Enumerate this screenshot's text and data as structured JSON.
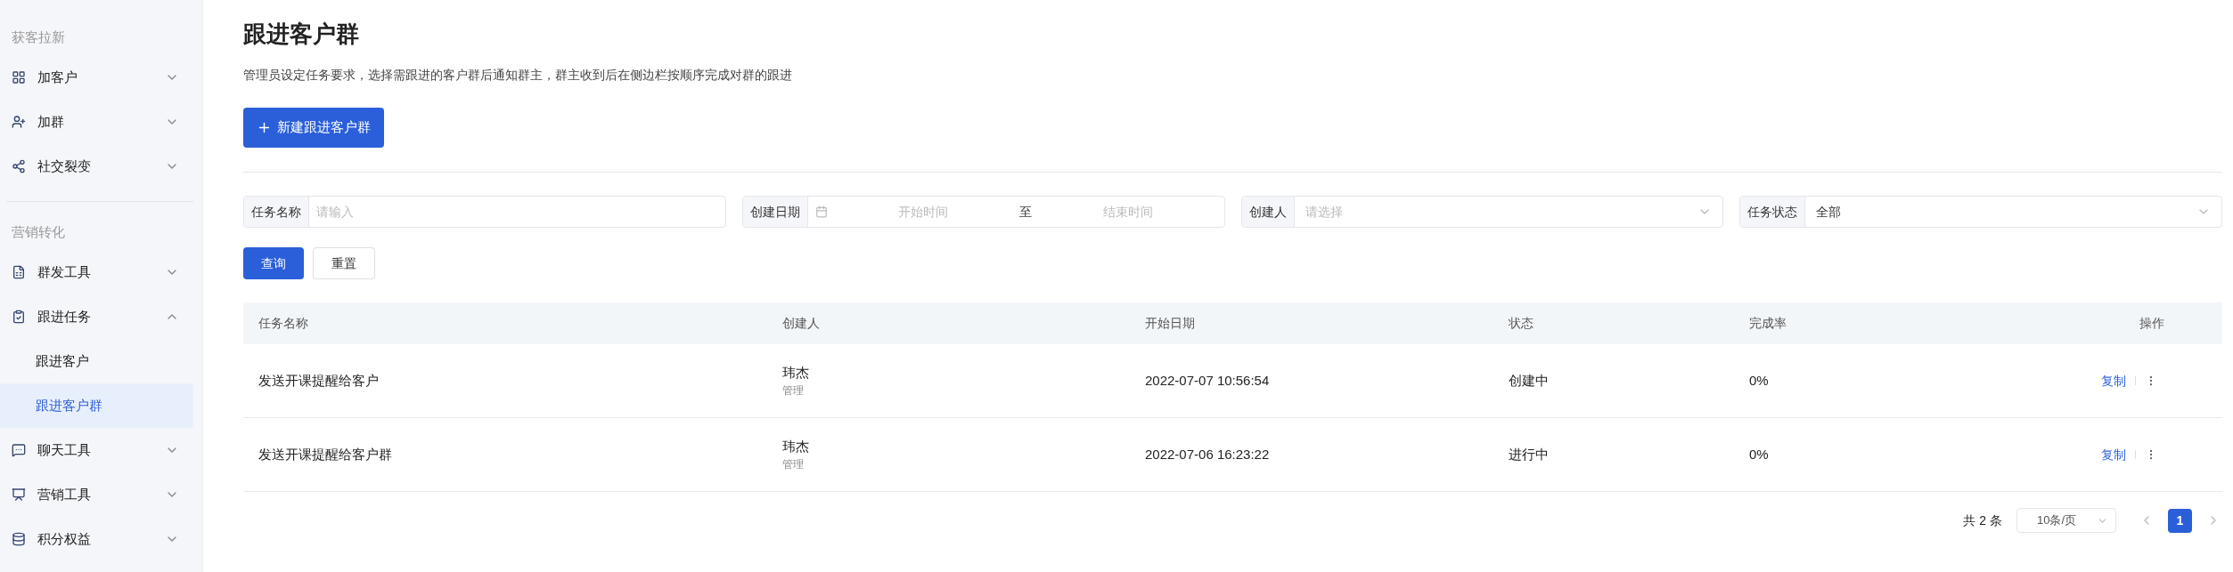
{
  "sidebar": {
    "groups": [
      {
        "title": "获客拉新",
        "items": [
          {
            "kind": "apps",
            "label": "加客户",
            "expanded": false
          },
          {
            "kind": "user-plus",
            "label": "加群",
            "expanded": false
          },
          {
            "kind": "share",
            "label": "社交裂变",
            "expanded": false
          }
        ]
      },
      {
        "title": "营销转化",
        "items": [
          {
            "kind": "send",
            "label": "群发工具",
            "expanded": false
          },
          {
            "kind": "task",
            "label": "跟进任务",
            "expanded": true,
            "children": [
              {
                "label": "跟进客户",
                "selected": false
              },
              {
                "label": "跟进客户群",
                "selected": true
              }
            ]
          },
          {
            "kind": "chat",
            "label": "聊天工具",
            "expanded": false
          },
          {
            "kind": "chart",
            "label": "营销工具",
            "expanded": false
          },
          {
            "kind": "coins",
            "label": "积分权益",
            "expanded": false
          }
        ]
      }
    ]
  },
  "page": {
    "title": "跟进客户群",
    "description": "管理员设定任务要求，选择需跟进的客户群后通知群主，群主收到后在侧边栏按顺序完成对群的跟进",
    "new_button": "新建跟进客户群"
  },
  "filters": [
    {
      "kind": "text",
      "label": "任务名称",
      "placeholder": "请输入"
    },
    {
      "kind": "date-range",
      "label": "创建日期",
      "start_placeholder": "开始时间",
      "separator": "至",
      "end_placeholder": "结束时间"
    },
    {
      "kind": "select",
      "label": "创建人",
      "placeholder": "请选择"
    },
    {
      "kind": "select",
      "label": "任务状态",
      "value": "全部"
    }
  ],
  "filter_buttons": {
    "query": "查询",
    "reset": "重置"
  },
  "table": {
    "columns": [
      "任务名称",
      "创建人",
      "开始日期",
      "状态",
      "完成率",
      "操作"
    ],
    "rows": [
      {
        "name": "发送开课提醒给客户",
        "creator": "玮杰",
        "creator_role": "管理",
        "start": "2022-07-07 10:56:54",
        "status": "创建中",
        "rate": "0%",
        "action": "复制"
      },
      {
        "name": "发送开课提醒给客户群",
        "creator": "玮杰",
        "creator_role": "管理",
        "start": "2022-07-06 16:23:22",
        "status": "进行中",
        "rate": "0%",
        "action": "复制"
      }
    ]
  },
  "pagination": {
    "total": "共 2 条",
    "page_size": "10条/页",
    "pages": [
      {
        "label": "1",
        "selected": true
      }
    ]
  }
}
